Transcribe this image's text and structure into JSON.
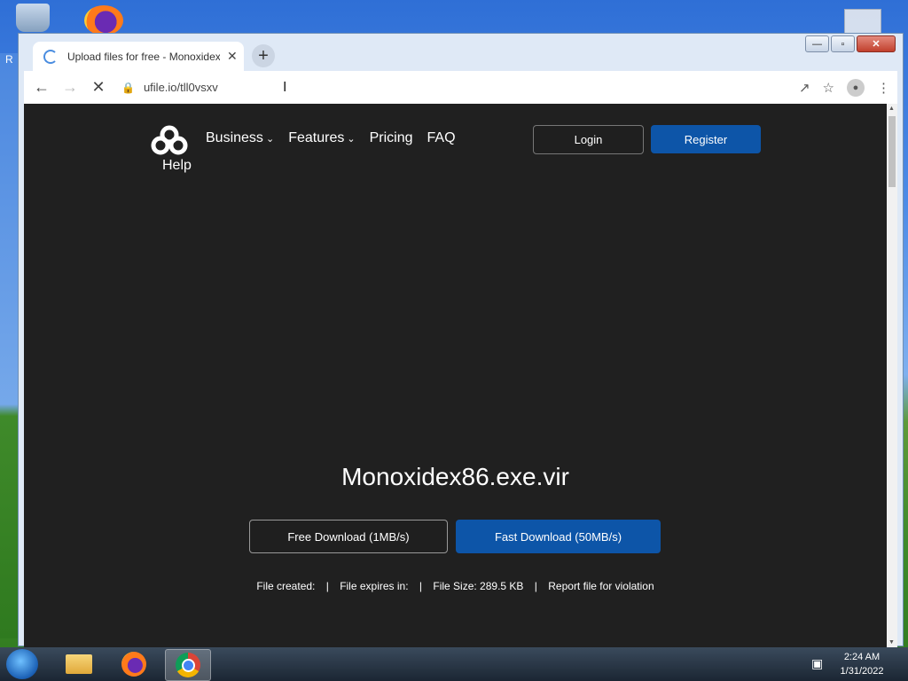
{
  "desktop": {
    "left_label": "R"
  },
  "browser": {
    "tab_title": "Upload files for free - Monoxidex",
    "tab_close": "✕",
    "newtab": "+",
    "url": "ufile.io/tll0vsxv",
    "window_buttons": {
      "minimize": "—",
      "maximize": "▫",
      "close": "✕"
    }
  },
  "site": {
    "nav": [
      "Business",
      "Features",
      "Pricing",
      "FAQ"
    ],
    "help": "Help",
    "login": "Login",
    "register": "Register",
    "filename": "Monoxidex86.exe.vir",
    "free_download": "Free Download (1MB/s)",
    "fast_download": "Fast Download (50MB/s)",
    "file_created": "File created:",
    "file_expires": "File expires in:",
    "file_size": "File Size: 289.5 KB",
    "report": "Report file for violation",
    "separator": "|"
  },
  "taskbar": {
    "time": "2:24 AM",
    "date": "1/31/2022"
  },
  "colors": {
    "page_bg": "#202020",
    "accent_blue": "#0d55a8"
  }
}
